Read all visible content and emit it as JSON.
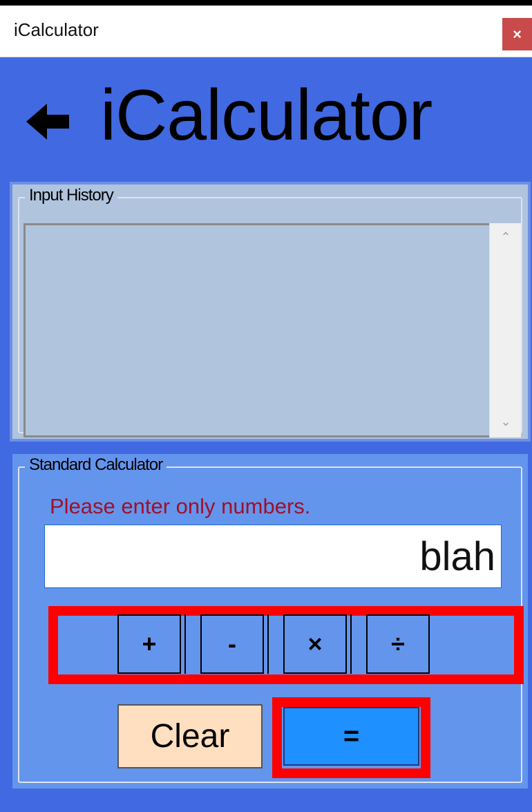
{
  "window": {
    "title": "iCalculator",
    "close_label": "×"
  },
  "header": {
    "back_icon": "back-arrow-icon",
    "title": "iCalculator"
  },
  "history": {
    "label": "Input History",
    "scroll_up": "⌃",
    "scroll_down": "⌄"
  },
  "calculator": {
    "label": "Standard Calculator",
    "error_message": "Please enter only numbers.",
    "input_value": "blah",
    "operators": [
      "+",
      "-",
      "×",
      "÷"
    ],
    "clear_label": "Clear",
    "equals_label": "="
  },
  "colors": {
    "window_background": "#4169e1",
    "history_background": "#b0c4de",
    "calculator_background": "#6495ed",
    "error_text": "#a01028",
    "clear_button": "#ffdfc0",
    "equals_button": "#1e90ff",
    "highlight": "#ff0000"
  }
}
